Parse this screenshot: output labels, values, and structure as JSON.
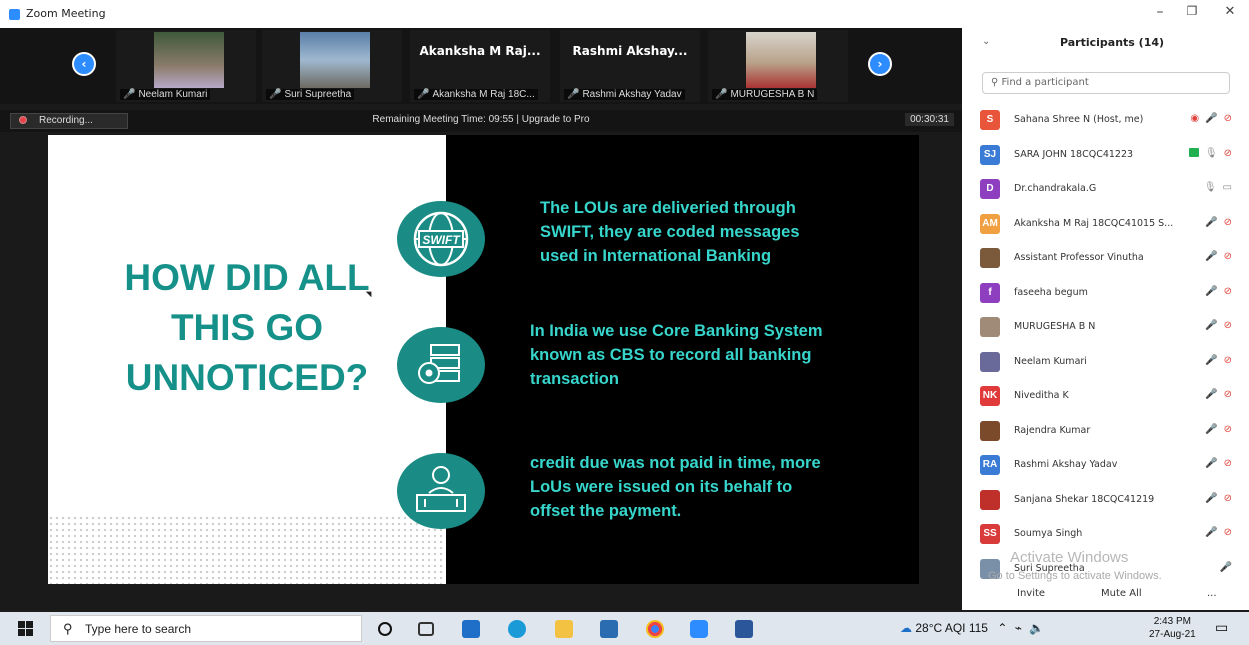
{
  "window": {
    "title": "Zoom Meeting",
    "minimize": "–",
    "restore": "❐",
    "close": "✕"
  },
  "video_strip": {
    "prev_arrow": "‹",
    "next_arrow": "›",
    "tiles": [
      {
        "display_name": "",
        "label": "Neelam Kumari",
        "thumb_color": "#8a7b6a"
      },
      {
        "display_name": "",
        "label": "Suri Supreetha",
        "thumb_color": "#9fb8cf"
      },
      {
        "display_name": "Akanksha M Raj...",
        "label": "Akanksha M Raj 18C...",
        "thumb_color": ""
      },
      {
        "display_name": "Rashmi Akshay...",
        "label": "Rashmi Akshay Yadav",
        "thumb_color": ""
      },
      {
        "display_name": "",
        "label": "MURUGESHA B N",
        "thumb_color": "#b9a28a"
      }
    ]
  },
  "infobar": {
    "recording": "Recording...",
    "remaining": "Remaining Meeting Time: 09:55 | Upgrade to Pro",
    "timer": "00:30:31"
  },
  "slide": {
    "headline": [
      "HOW DID ALL",
      "THIS GO",
      "UNNOTICED?"
    ],
    "points": [
      {
        "icon": "swift-globe-icon",
        "icon_text": "SWIFT",
        "lines": [
          "The LOUs are deliveried through",
          "SWIFT, they are coded messages",
          "used in International Banking"
        ]
      },
      {
        "icon": "server-gear-icon",
        "icon_text": "",
        "lines": [
          "In India we use Core Banking System",
          "known as CBS to record all banking",
          "transaction"
        ]
      },
      {
        "icon": "bank-teller-icon",
        "icon_text": "",
        "lines": [
          "credit due was not paid in time, more",
          "LoUs were issued on its behalf to",
          "offset the payment."
        ]
      }
    ]
  },
  "participants": {
    "title": "Participants (14)",
    "collapse": "⌄",
    "search_placeholder": "Find a participant",
    "list": [
      {
        "initials": "S",
        "color": "#e8553a",
        "name": "Sahana Shree N (Host, me)",
        "icons": [
          "rec",
          "mic",
          "cam"
        ]
      },
      {
        "initials": "SJ",
        "color": "#3a7bd5",
        "name": "SARA JOHN 18CQC41223",
        "icons": [
          "green",
          "ok",
          "cam"
        ]
      },
      {
        "initials": "D",
        "color": "#8e3fbf",
        "name": "Dr.chandrakala.G",
        "icons": [
          "okmic",
          "okcam"
        ]
      },
      {
        "initials": "AM",
        "color": "#f0a040",
        "name": "Akanksha M Raj 18CQC41015 S...",
        "icons": [
          "mic",
          "cam"
        ]
      },
      {
        "initials": "",
        "color": "#7a5a3a",
        "name": "Assistant Professor Vinutha",
        "icons": [
          "mic",
          "cam"
        ]
      },
      {
        "initials": "f",
        "color": "#8e3fbf",
        "name": "faseeha begum",
        "icons": [
          "mic",
          "cam"
        ]
      },
      {
        "initials": "",
        "color": "#a08a78",
        "name": "MURUGESHA B N",
        "icons": [
          "mic",
          "cam"
        ]
      },
      {
        "initials": "",
        "color": "#6a6a9a",
        "name": "Neelam Kumari",
        "icons": [
          "mic",
          "cam"
        ]
      },
      {
        "initials": "NK",
        "color": "#e03a3a",
        "name": "Niveditha K",
        "icons": [
          "mic",
          "cam"
        ]
      },
      {
        "initials": "",
        "color": "#7a4a2a",
        "name": "Rajendra Kumar",
        "icons": [
          "mic",
          "cam"
        ]
      },
      {
        "initials": "RA",
        "color": "#3a7bd5",
        "name": "Rashmi Akshay Yadav",
        "icons": [
          "mic",
          "cam"
        ]
      },
      {
        "initials": "",
        "color": "#c0302a",
        "name": "Sanjana Shekar 18CQC41219",
        "icons": [
          "mic",
          "cam"
        ]
      },
      {
        "initials": "SS",
        "color": "#d93a3a",
        "name": "Soumya Singh",
        "icons": [
          "mic",
          "cam"
        ]
      },
      {
        "initials": "",
        "color": "#7a90a8",
        "name": "Suri Supreetha",
        "icons": [
          "mic"
        ]
      }
    ],
    "invite": "Invite",
    "mute_all": "Mute All",
    "more": "..."
  },
  "watermark": {
    "line1": "Activate Windows",
    "line2": "Go to Settings to activate Windows."
  },
  "taskbar": {
    "search_placeholder": "Type here to search",
    "weather": "28°C",
    "aqi": "AQI 115",
    "time": "2:43 PM",
    "date": "27-Aug-21"
  }
}
